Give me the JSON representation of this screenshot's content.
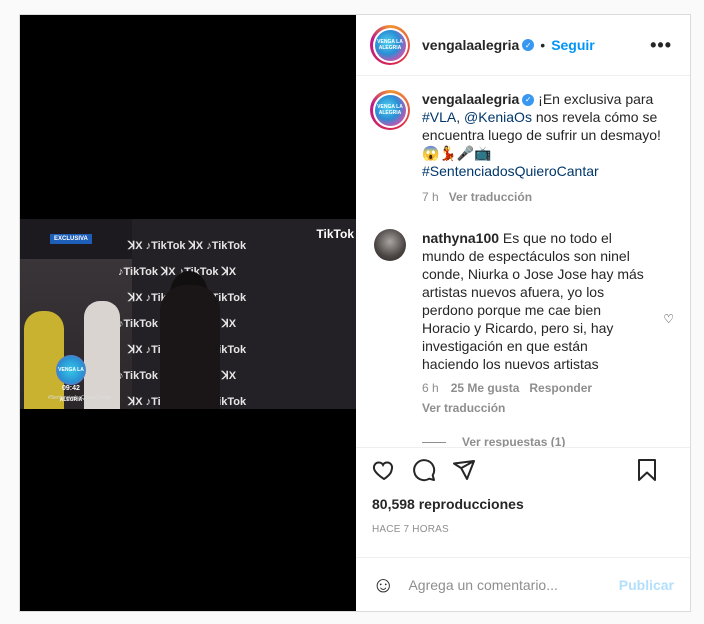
{
  "header": {
    "username": "vengalaalegria",
    "dot": "•",
    "follow_label": "Seguir",
    "more_label": "•••",
    "avatar_text": "VENGA LA ALEGRIA"
  },
  "video": {
    "badge": "EXCLUSIVA",
    "logo_text": "VENGA LA ALEGRIA",
    "time": "09:42",
    "hashtag": "#SentenciadosQuieroCantar",
    "corner_brand": "TikTok",
    "backdrop_rows": [
      "ꓘX ♪TikTok ꓘX ♪TikTok",
      "♪TikTok ꓘX ♪TikTok ꓘX",
      "ꓘX ♪TikTok ꓘX ♪TikTok",
      "♪TikTok ꓘX ♪TikTok ꓘX",
      "ꓘX ♪TikTok ꓘX ♪TikTok",
      "♪TikTok ꓘX ♪TikTok ꓘX",
      "ꓘX ♪TikTok ꓘX ♪TikTok"
    ]
  },
  "caption": {
    "username": "vengalaalegria",
    "text_1": " ¡En exclusiva para ",
    "link_1": "#VLA",
    "text_2": ", ",
    "link_2": "@KeniaOs",
    "text_3": " nos revela cómo se encuentra luego de sufrir un desmayo! 😱💃🎤📺",
    "link_3": "#SentenciadosQuieroCantar",
    "time": "7 h",
    "translate": "Ver traducción"
  },
  "comment": {
    "username": "nathyna100",
    "text": " Es que no todo el mundo de espectáculos son ninel conde, Niurka o Jose Jose hay más artistas nuevos afuera, yo los perdono porque me cae bien Horacio y Ricardo, pero si, hay investigación en que están haciendo los nuevos artistas",
    "time": "6 h",
    "likes": "25 Me gusta",
    "reply": "Responder",
    "translate": "Ver traducción",
    "replies": "Ver respuestas (1)"
  },
  "stats": {
    "views": "80,598 reproducciones",
    "age": "HACE 7 HORAS"
  },
  "compose": {
    "placeholder": "Agrega un comentario...",
    "publish": "Publicar",
    "emoji_icon": "☺"
  },
  "colors": {
    "accent": "#0095f6",
    "link": "#00376b",
    "muted": "#8e8e8e",
    "publish_disabled": "#b2dffc"
  }
}
